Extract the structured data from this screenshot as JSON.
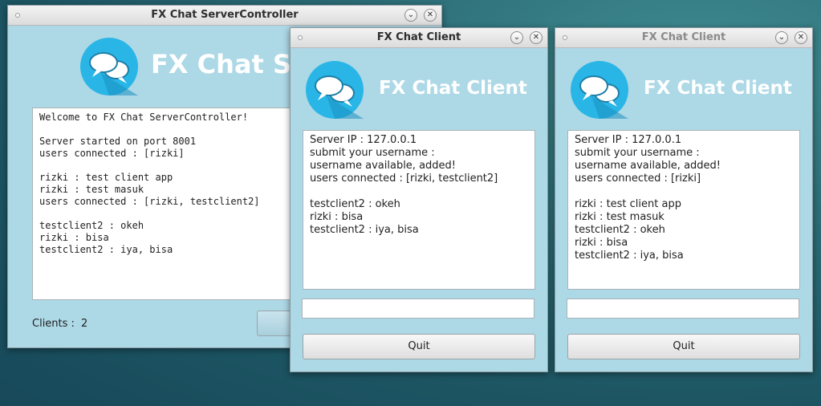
{
  "server": {
    "title": "FX Chat ServerController",
    "headline": "FX Chat ServerController",
    "log_lines": [
      "Welcome to FX Chat ServerController!",
      "",
      "Server started on port 8001",
      "users connected : [rizki]",
      "",
      "rizki : test client app",
      "rizki : test masuk",
      "users connected : [rizki, testclient2]",
      "",
      "testclient2 : okeh",
      "rizki : bisa",
      "testclient2 : iya, bisa"
    ],
    "clients_label": "Clients :",
    "clients_count": "2"
  },
  "client1": {
    "title": "FX Chat Client",
    "headline": "FX Chat Client",
    "log_lines": [
      "Server IP : 127.0.0.1",
      "submit your username :",
      "username available, added!",
      "users connected : [rizki, testclient2]",
      "",
      "testclient2 : okeh",
      "rizki : bisa",
      "testclient2 : iya, bisa"
    ],
    "message_value": "",
    "quit_label": "Quit"
  },
  "client2": {
    "title": "FX Chat Client",
    "headline": "FX Chat Client",
    "log_lines": [
      "Server IP : 127.0.0.1",
      "submit your username :",
      "username available, added!",
      "users connected : [rizki]",
      "",
      "rizki : test client app",
      "rizki : test masuk",
      "testclient2 : okeh",
      "rizki : bisa",
      "testclient2 : iya, bisa"
    ],
    "message_value": "",
    "quit_label": "Quit"
  },
  "titlebar_buttons": {
    "minimize": "⌄",
    "close": "✕"
  },
  "colors": {
    "window_bg": "#add8e6",
    "logo_circle": "#29b6e6",
    "desktop": "#2c6d77"
  }
}
